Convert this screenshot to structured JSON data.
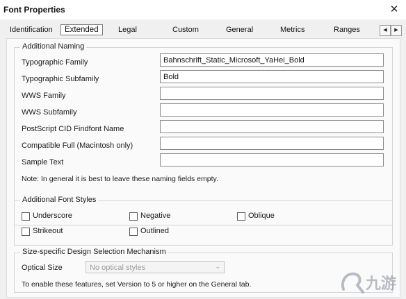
{
  "window": {
    "title": "Font Properties",
    "close_glyph": "✕"
  },
  "tabs": [
    {
      "label": "Identification",
      "active": false
    },
    {
      "label": "Extended",
      "active": true
    },
    {
      "label": "Legal",
      "active": false
    },
    {
      "label": "Custom",
      "active": false
    },
    {
      "label": "General",
      "active": false
    },
    {
      "label": "Metrics",
      "active": false
    },
    {
      "label": "Ranges",
      "active": false
    }
  ],
  "tab_scroll": {
    "left_icon": "◀",
    "right_icon": "▶"
  },
  "additional_naming": {
    "title": "Additional Naming",
    "fields": [
      {
        "label": "Typographic Family",
        "value": "Bahnschrift_Static_Microsoft_YaHei_Bold"
      },
      {
        "label": "Typographic Subfamily",
        "value": "Bold"
      },
      {
        "label": "WWS Family",
        "value": ""
      },
      {
        "label": "WWS Subfamily",
        "value": ""
      },
      {
        "label": "PostScript CID Findfont Name",
        "value": ""
      },
      {
        "label": "Compatible Full (Macintosh only)",
        "value": ""
      },
      {
        "label": "Sample Text",
        "value": ""
      }
    ],
    "note": "Note: In general it is best to leave these naming fields empty."
  },
  "additional_font_styles": {
    "title": "Additional Font Styles",
    "checkboxes": [
      {
        "label": "Underscore",
        "checked": false
      },
      {
        "label": "Negative",
        "checked": false
      },
      {
        "label": "Oblique",
        "checked": false
      },
      {
        "label": "Strikeout",
        "checked": false
      },
      {
        "label": "Outlined",
        "checked": false
      }
    ]
  },
  "design_selection": {
    "title": "Size-specific Design Selection Mechanism",
    "optical_size_label": "Optical Size",
    "optical_size_value": "No optical styles",
    "note": "To enable these features, set Version to 5 or higher on the General tab."
  },
  "watermark": {
    "text": "九游"
  },
  "colors": {
    "watermark": "#7f8a96",
    "page_bg": "#fafafa",
    "dialog_bg": "#f0f0f0"
  }
}
